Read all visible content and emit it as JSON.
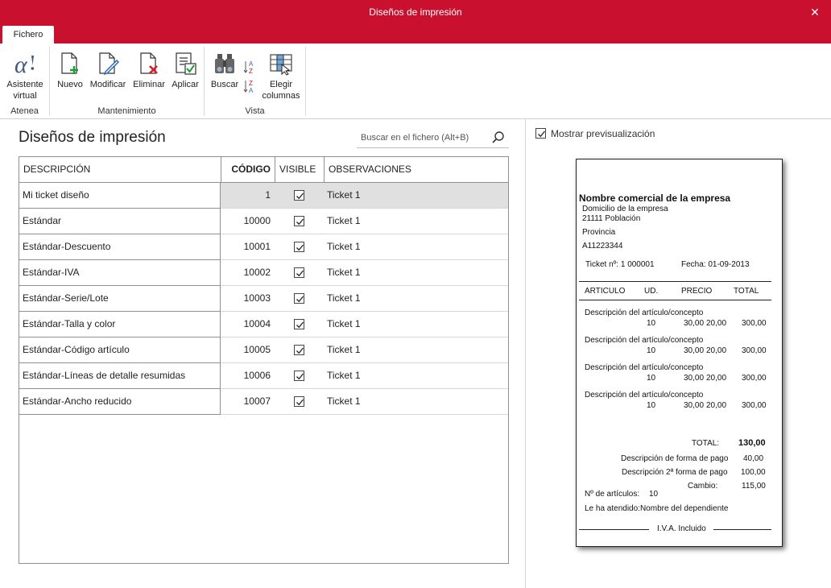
{
  "window": {
    "title": "Diseños de impresión",
    "close_glyph": "✕"
  },
  "ribbon": {
    "tab": "Fichero",
    "groups": {
      "atenea": {
        "label": "Atenea",
        "asistente": "Asistente virtual"
      },
      "mantenimiento": {
        "label": "Mantenimiento",
        "nuevo": "Nuevo",
        "modificar": "Modificar",
        "eliminar": "Eliminar",
        "aplicar": "Aplicar"
      },
      "vista": {
        "label": "Vista",
        "buscar": "Buscar",
        "elegir": "Elegir columnas",
        "sort_asc": "A Z",
        "sort_desc": "Z A"
      }
    }
  },
  "main": {
    "title": "Diseños de impresión",
    "search_placeholder": "Buscar en el fichero (Alt+B)",
    "columns": {
      "descripcion": "DESCRIPCIÓN",
      "codigo": "CÓDIGO",
      "visible": "VISIBLE",
      "observaciones": "OBSERVACIONES"
    },
    "rows": [
      {
        "descripcion": "Mi ticket diseño",
        "codigo": "1",
        "visible": true,
        "observaciones": "Ticket 1",
        "selected": true
      },
      {
        "descripcion": "Estándar",
        "codigo": "10000",
        "visible": true,
        "observaciones": "Ticket 1"
      },
      {
        "descripcion": "Estándar-Descuento",
        "codigo": "10001",
        "visible": true,
        "observaciones": "Ticket 1"
      },
      {
        "descripcion": "Estándar-IVA",
        "codigo": "10002",
        "visible": true,
        "observaciones": "Ticket 1"
      },
      {
        "descripcion": "Estándar-Serie/Lote",
        "codigo": "10003",
        "visible": true,
        "observaciones": "Ticket 1"
      },
      {
        "descripcion": "Estándar-Talla y color",
        "codigo": "10004",
        "visible": true,
        "observaciones": "Ticket 1"
      },
      {
        "descripcion": "Estándar-Código artículo",
        "codigo": "10005",
        "visible": true,
        "observaciones": "Ticket 1"
      },
      {
        "descripcion": "Estándar-Líneas de detalle resumidas",
        "codigo": "10006",
        "visible": true,
        "observaciones": "Ticket 1"
      },
      {
        "descripcion": "Estándar-Ancho reducido",
        "codigo": "10007",
        "visible": true,
        "observaciones": "Ticket 1"
      }
    ]
  },
  "preview": {
    "toggle_label": "Mostrar previsualización",
    "toggle_checked": true,
    "ticket": {
      "company": "Nombre  comercial de la empresa",
      "address": "Domicilio de la empresa",
      "postal": "21111   Población",
      "province": "Provincia",
      "nif": "A11223344",
      "ticket_no": "Ticket nº:  1  000001",
      "date": "Fecha:  01-09-2013",
      "headers": {
        "articulo": "ARTICULO",
        "ud": "UD.",
        "precio": "PRECIO",
        "total": "TOTAL"
      },
      "items": [
        {
          "desc": "Descripción del artículo/concepto",
          "ud": "10",
          "precio": "30,00",
          "dto": "20,00",
          "total": "300,00"
        },
        {
          "desc": "Descripción del artículo/concepto",
          "ud": "10",
          "precio": "30,00",
          "dto": "20,00",
          "total": "300,00"
        },
        {
          "desc": "Descripción del artículo/concepto",
          "ud": "10",
          "precio": "30,00",
          "dto": "20,00",
          "total": "300,00"
        },
        {
          "desc": "Descripción del artículo/concepto",
          "ud": "10",
          "precio": "30,00",
          "dto": "20,00",
          "total": "300,00"
        }
      ],
      "total_label": "TOTAL:",
      "total_value": "130,00",
      "pay1_label": "Descripción de forma de pago",
      "pay1_value": "40,00",
      "pay2_label": "Descripción 2ª forma de pago",
      "pay2_value": "100,00",
      "change_label": "Cambio:",
      "change_value": "115,00",
      "num_items_label": "Nº de artículos:",
      "num_items_value": "10",
      "served_by": "Le ha atendido:Nombre del dependiente",
      "iva_note": "I.V.A. Incluido"
    }
  },
  "colors": {
    "brand": "#c9102e",
    "selected_row": "#e0e0e0"
  }
}
